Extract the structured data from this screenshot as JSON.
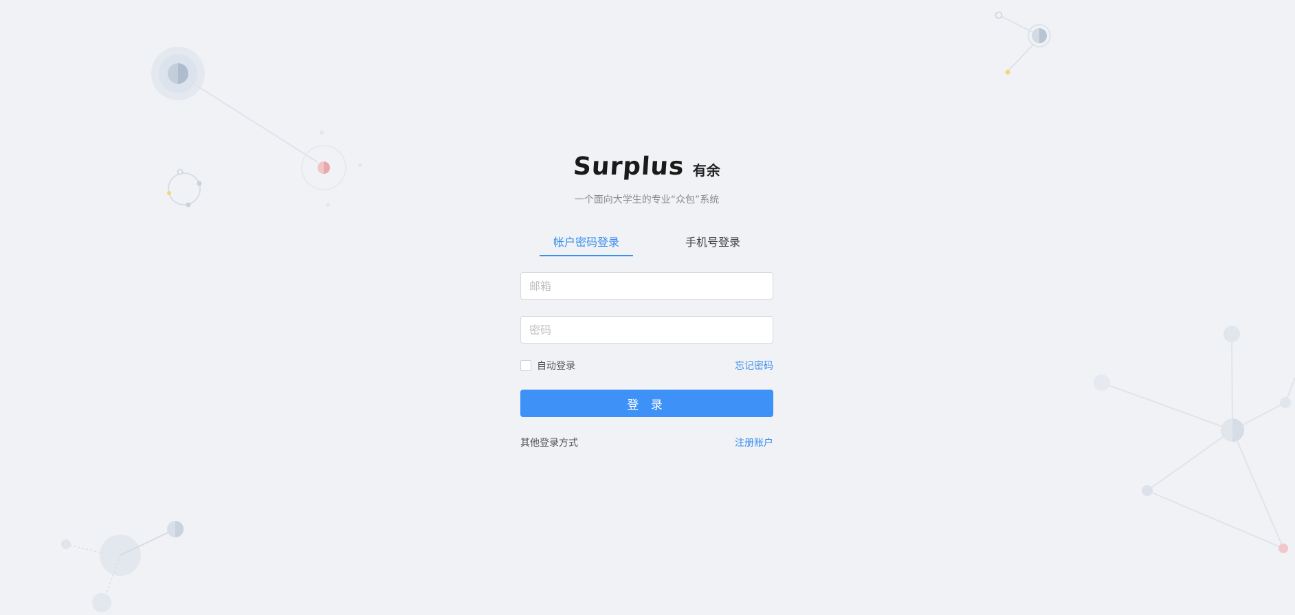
{
  "brand": {
    "logo_text": "Surplus",
    "name": "有余",
    "subtitle": "一个面向大学生的专业“众包”系统"
  },
  "tabs": [
    {
      "label": "帐户密码登录",
      "active": true
    },
    {
      "label": "手机号登录",
      "active": false
    }
  ],
  "form": {
    "email_placeholder": "邮箱",
    "email_value": "",
    "password_placeholder": "密码",
    "password_value": "",
    "remember_label": "自动登录",
    "remember_checked": false,
    "forgot_label": "忘记密码",
    "submit_label": "登 录"
  },
  "footer": {
    "other_login_label": "其他登录方式",
    "register_label": "注册账户"
  },
  "colors": {
    "accent": "#3b8ff0",
    "background": "#f0f2f5"
  }
}
